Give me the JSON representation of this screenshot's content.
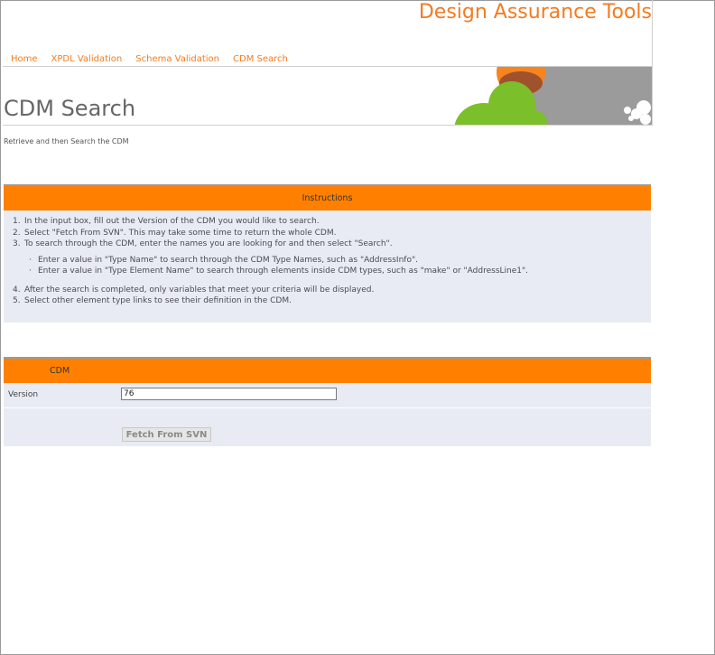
{
  "site": {
    "title": "Design Assurance Tools"
  },
  "nav": {
    "items": [
      "Home",
      "XPDL Validation",
      "Schema Validation",
      "CDM Search"
    ]
  },
  "page": {
    "title": "CDM Search",
    "subtitle": "Retrieve and then Search the CDM"
  },
  "instructions": {
    "heading": "Instructions",
    "steps_a": [
      "In the input box, fill out the Version of the CDM you would like to search.",
      "Select \"Fetch From SVN\". This may take some time to return the whole CDM.",
      "To search through the CDM, enter the names you are looking for and then select \"Search\"."
    ],
    "substeps": [
      "Enter a value in \"Type Name\" to search through the CDM Type Names, such as \"AddressInfo\".",
      "Enter a value in \"Type Element Name\" to search through elements inside CDM types, such as \"make\" or \"AddressLine1\"."
    ],
    "steps_b": [
      "After the search is completed, only variables that meet your criteria will be displayed.",
      "Select other element type links to see their definition in the CDM."
    ],
    "numbers": [
      "1.",
      "2.",
      "3.",
      "4.",
      "5."
    ],
    "bullet": "·"
  },
  "cdm": {
    "heading": "CDM",
    "version_label": "Version",
    "version_value": "76",
    "fetch_label": "Fetch From SVN"
  },
  "colors": {
    "accent": "#ff8000",
    "link": "#f47b20",
    "panel_bg": "#e8ebf3",
    "art_orange": "#f7841f",
    "art_brown": "#a0522d",
    "art_green": "#7bbf2a",
    "art_gray": "#9b9b9b"
  }
}
